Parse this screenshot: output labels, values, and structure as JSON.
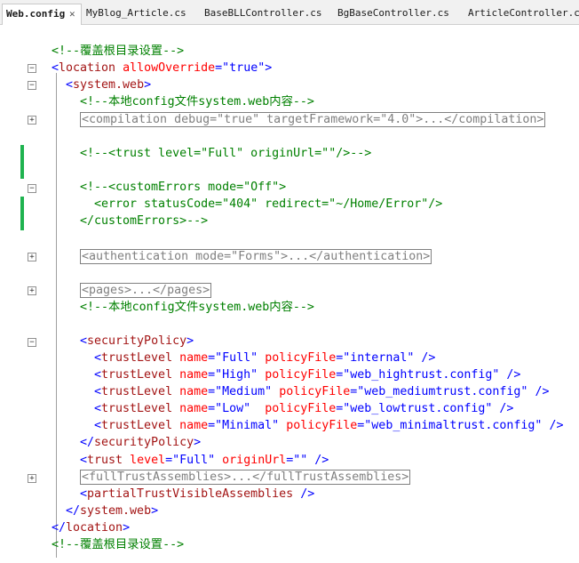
{
  "tabs": [
    {
      "label": "Web.config",
      "close_glyph": "✕",
      "active": true
    },
    {
      "label": "MyBlog_Article.cs"
    },
    {
      "label": "BaseBLLController.cs"
    },
    {
      "label": "BgBaseController.cs"
    },
    {
      "label": "ArticleController.cs"
    }
  ],
  "colors": {
    "comment": "#008000",
    "bracket": "#0000ff",
    "tag": "#a31515",
    "attribute": "#ff0000",
    "value": "#0000ff",
    "collapsed": "#808080",
    "change_bar": "#1fb34f"
  },
  "code": {
    "l1": {
      "comment": "<!--覆盖根目录设置-->"
    },
    "l2": {
      "open": "<",
      "tag": "location",
      "attr": "allowOverride",
      "eq": "=",
      "val": "\"true\"",
      "close": ">"
    },
    "l3": {
      "open": "<",
      "tag": "system.web",
      "close": ">"
    },
    "l4": {
      "comment": "<!--本地config文件system.web内容-->"
    },
    "l5": {
      "collapsed": "<compilation debug=\"true\" targetFramework=\"4.0\">...</compilation>"
    },
    "l6": {
      "comment": "<!--<trust level=\"Full\" originUrl=\"\"/>-->"
    },
    "l7": {
      "comment": "<!--<customErrors mode=\"Off\">"
    },
    "l8": {
      "comment": "<error statusCode=\"404\" redirect=\"~/Home/Error\"/>"
    },
    "l9": {
      "comment": "</customErrors>-->"
    },
    "l10": {
      "collapsed": "<authentication mode=\"Forms\">...</authentication>"
    },
    "l11": {
      "collapsed": "<pages>...</pages>"
    },
    "l12": {
      "comment": "<!--本地config文件system.web内容-->"
    },
    "l13": {
      "open": "<",
      "tag": "securityPolicy",
      "close": ">"
    },
    "l14": {
      "open": "<",
      "tag": "trustLevel",
      "a1": "name",
      "v1": "\"Full\"",
      "a2": "policyFile",
      "v2": "\"internal\"",
      "close": "/>"
    },
    "l15": {
      "open": "<",
      "tag": "trustLevel",
      "a1": "name",
      "v1": "\"High\"",
      "a2": "policyFile",
      "v2": "\"web_hightrust.config\"",
      "close": "/>"
    },
    "l16": {
      "open": "<",
      "tag": "trustLevel",
      "a1": "name",
      "v1": "\"Medium\"",
      "a2": "policyFile",
      "v2": "\"web_mediumtrust.config\"",
      "close": "/>"
    },
    "l17": {
      "open": "<",
      "tag": "trustLevel",
      "a1": "name",
      "v1": "\"Low\"",
      "a2": "policyFile",
      "v2": "\"web_lowtrust.config\"",
      "close": "/>"
    },
    "l18": {
      "open": "<",
      "tag": "trustLevel",
      "a1": "name",
      "v1": "\"Minimal\"",
      "a2": "policyFile",
      "v2": "\"web_minimaltrust.config\"",
      "close": "/>"
    },
    "l19": {
      "open": "</",
      "tag": "securityPolicy",
      "close": ">"
    },
    "l20": {
      "open": "<",
      "tag": "trust",
      "a1": "level",
      "v1": "\"Full\"",
      "a2": "originUrl",
      "v2": "\"\"",
      "close": "/>"
    },
    "l21": {
      "collapsed": "<fullTrustAssemblies>...</fullTrustAssemblies>"
    },
    "l22": {
      "open": "<",
      "tag": "partialTrustVisibleAssemblies",
      "close": "/>"
    },
    "l23": {
      "open": "</",
      "tag": "system.web",
      "close": ">"
    },
    "l24": {
      "open": "</",
      "tag": "location",
      "close": ">"
    },
    "l25": {
      "comment": "<!--覆盖根目录设置-->"
    }
  },
  "fold_glyphs": {
    "expanded": "−",
    "collapsed": "+"
  }
}
